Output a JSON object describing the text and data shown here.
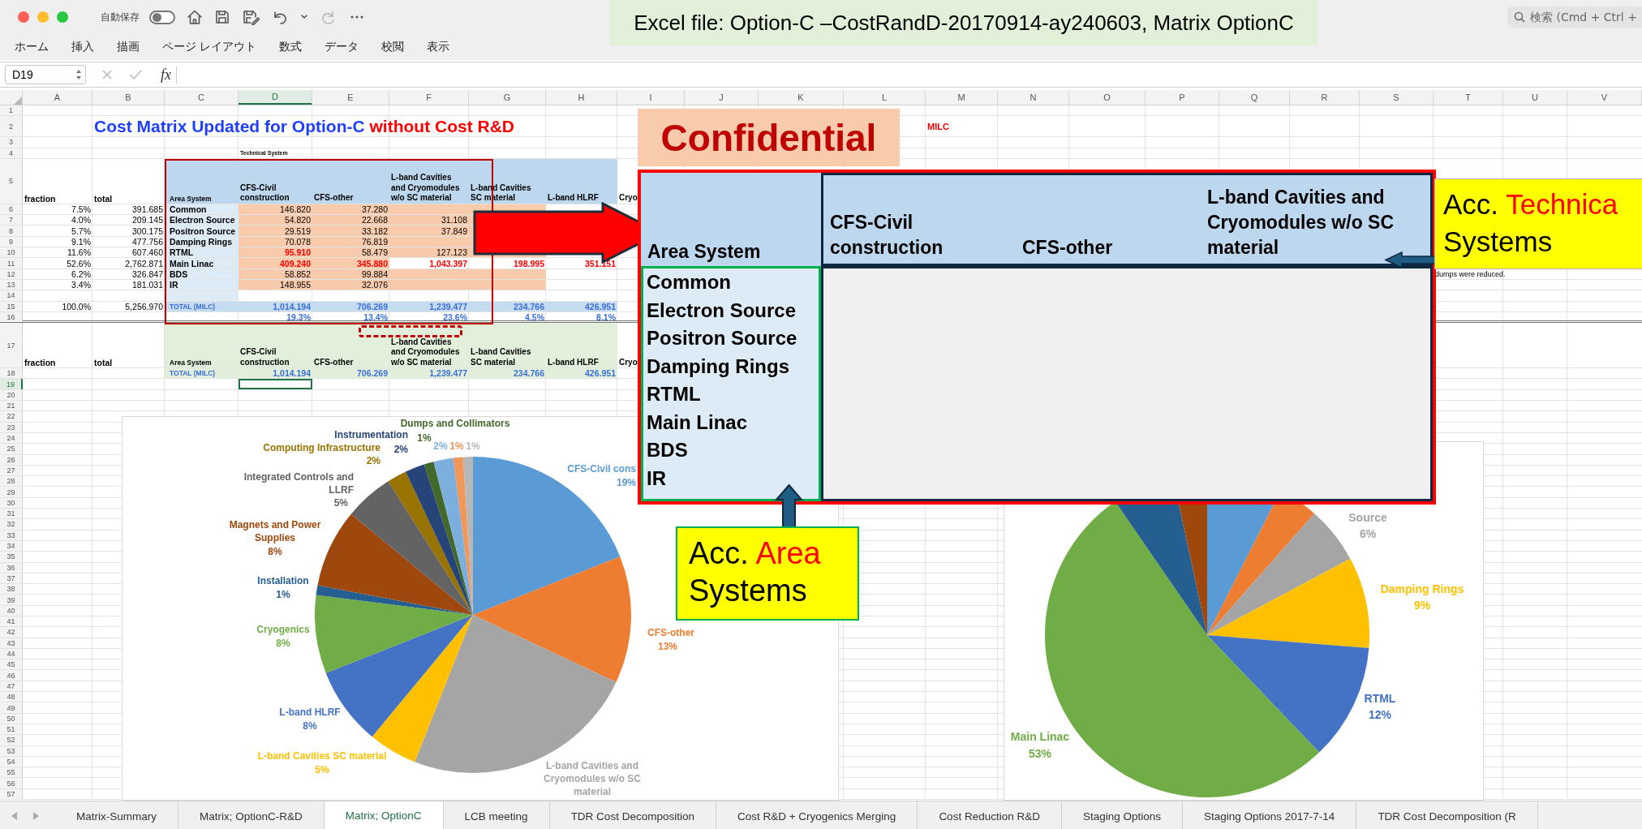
{
  "title_bar": {
    "autosave": {
      "label": "自動保存",
      "on": false
    },
    "quick_access": [
      {
        "kind": "home",
        "disabled": false
      },
      {
        "kind": "save",
        "disabled": false
      },
      {
        "kind": "save-as",
        "disabled": false
      },
      {
        "kind": "undo",
        "disabled": false
      },
      {
        "kind": "caret",
        "disabled": false
      },
      {
        "kind": "redo",
        "disabled": true
      },
      {
        "kind": "more",
        "disabled": false
      }
    ],
    "search": {
      "placeholder": "検索 (Cmd + Ctrl +"
    }
  },
  "caption": "Excel file: Option-C –CostRandD-20170914-ay240603, Matrix OptionC",
  "ribbon_tabs": [
    "ホーム",
    "挿入",
    "描画",
    "ページ レイアウト",
    "数式",
    "データ",
    "校閲",
    "表示"
  ],
  "formula_bar": {
    "name_box": "D19",
    "function_label": "fx"
  },
  "sheet": {
    "columns": [
      {
        "label": "A",
        "selected": false
      },
      {
        "label": "B",
        "selected": false
      },
      {
        "label": "C",
        "selected": false
      },
      {
        "label": "D",
        "selected": true
      },
      {
        "label": "E",
        "selected": false
      },
      {
        "label": "F",
        "selected": false
      },
      {
        "label": "G",
        "selected": false
      },
      {
        "label": "H",
        "selected": false
      },
      {
        "label": "I",
        "selected": false
      },
      {
        "label": "J",
        "selected": false
      },
      {
        "label": "K",
        "selected": false
      },
      {
        "label": "L",
        "selected": false
      },
      {
        "label": "M",
        "selected": false
      },
      {
        "label": "N",
        "selected": false
      },
      {
        "label": "O",
        "selected": false
      },
      {
        "label": "P",
        "selected": false
      },
      {
        "label": "Q",
        "selected": false
      },
      {
        "label": "R",
        "selected": false
      },
      {
        "label": "S",
        "selected": false
      },
      {
        "label": "T",
        "selected": false
      },
      {
        "label": "U",
        "selected": false
      },
      {
        "label": "V",
        "selected": false
      }
    ],
    "rows": [
      {
        "header": "1",
        "selected": false
      },
      {
        "header": "2",
        "selected": false,
        "kind": "title",
        "cells": [
          null,
          {
            "kind": "title",
            "parts": [
              {
                "text": "Cost Matrix Updated for Option-C",
                "color": "#1f3fff"
              },
              {
                "text": "without Cost R&D",
                "color": "#ff0000"
              }
            ]
          },
          null,
          null,
          null,
          null,
          null,
          null,
          null,
          null,
          null,
          null,
          {
            "kind": "note",
            "text": "MILC",
            "color": "#ff0000"
          }
        ]
      },
      {
        "header": "3",
        "selected": false
      },
      {
        "header": "4",
        "selected": false,
        "cells": [
          null,
          null,
          null,
          {
            "kind": "tiny",
            "text": "Technical System"
          }
        ]
      },
      {
        "header": "5",
        "selected": false,
        "kind": "head",
        "cells": [
          {
            "text": "fraction",
            "kind": "label"
          },
          {
            "text": "total",
            "kind": "label"
          },
          {
            "text": "Area System",
            "kind": "small"
          },
          {
            "text": "CFS-Civil construction",
            "kind": "head"
          },
          {
            "text": "CFS-other",
            "kind": "head"
          },
          {
            "text": "L-band Cavities and Cryomodules w/o SC material",
            "kind": "head"
          },
          {
            "text": "L-band Cavities SC material",
            "kind": "head"
          },
          {
            "text": "L-band HLRF",
            "kind": "head"
          },
          {
            "text": "Cryo",
            "kind": "head"
          }
        ]
      },
      {
        "header": "6",
        "selected": false,
        "kind": "data",
        "cells": [
          {
            "text": "7.5%",
            "kind": "num"
          },
          {
            "text": "391.685",
            "kind": "num"
          },
          {
            "text": "Common",
            "kind": "label"
          },
          {
            "text": "146.820",
            "kind": "num"
          },
          {
            "text": "37.280",
            "kind": "num"
          }
        ]
      },
      {
        "header": "7",
        "selected": false,
        "kind": "data",
        "cells": [
          {
            "text": "4.0%",
            "kind": "num"
          },
          {
            "text": "209.145",
            "kind": "num"
          },
          {
            "text": "Electron Source",
            "kind": "label"
          },
          {
            "text": "54.820",
            "kind": "num"
          },
          {
            "text": "22.668",
            "kind": "num"
          },
          {
            "text": "31.108",
            "kind": "num"
          }
        ]
      },
      {
        "header": "8",
        "selected": false,
        "kind": "data",
        "cells": [
          {
            "text": "5.7%",
            "kind": "num"
          },
          {
            "text": "300.175",
            "kind": "num"
          },
          {
            "text": "Positron Source",
            "kind": "label"
          },
          {
            "text": "29.519",
            "kind": "num"
          },
          {
            "text": "33.182",
            "kind": "num"
          },
          {
            "text": "37.849",
            "kind": "num"
          }
        ]
      },
      {
        "header": "9",
        "selected": false,
        "kind": "data",
        "cells": [
          {
            "text": "9.1%",
            "kind": "num"
          },
          {
            "text": "477.756",
            "kind": "num"
          },
          {
            "text": "Damping Rings",
            "kind": "label"
          },
          {
            "text": "70.078",
            "kind": "num"
          },
          {
            "text": "76.819",
            "kind": "num"
          }
        ]
      },
      {
        "header": "10",
        "selected": false,
        "kind": "data",
        "cells": [
          {
            "text": "11.6%",
            "kind": "num"
          },
          {
            "text": "607.460",
            "kind": "num"
          },
          {
            "text": "RTML",
            "kind": "label"
          },
          {
            "text": "95.910",
            "kind": "num",
            "color": "#ff0000"
          },
          {
            "text": "58.479",
            "kind": "num"
          },
          {
            "text": "127.123",
            "kind": "num"
          }
        ]
      },
      {
        "header": "11",
        "selected": false,
        "kind": "data-main",
        "cells": [
          {
            "text": "52.6%",
            "kind": "num"
          },
          {
            "text": "2,762.871",
            "kind": "num"
          },
          {
            "text": "Main Linac",
            "kind": "label"
          },
          {
            "text": "409.240",
            "kind": "num",
            "color": "#ff0000"
          },
          {
            "text": "345.880",
            "kind": "num",
            "color": "#ff0000"
          },
          {
            "text": "1,043.397",
            "kind": "num",
            "color": "#ff0000"
          },
          {
            "text": "198.995",
            "kind": "num",
            "color": "#ff0000"
          },
          {
            "text": "351.151",
            "kind": "num",
            "color": "#ff0000"
          }
        ]
      },
      {
        "header": "12",
        "selected": false,
        "kind": "data",
        "cells": [
          {
            "text": "6.2%",
            "kind": "num"
          },
          {
            "text": "326.847",
            "kind": "num"
          },
          {
            "text": "BDS",
            "kind": "label"
          },
          {
            "text": "58.852",
            "kind": "num"
          },
          {
            "text": "99.884",
            "kind": "num"
          },
          null,
          null,
          null,
          null,
          null,
          null,
          null,
          null,
          null,
          null,
          null,
          null,
          null,
          null,
          {
            "text": "dumps were reduced.",
            "kind": "text"
          }
        ]
      },
      {
        "header": "13",
        "selected": false,
        "kind": "data",
        "cells": [
          {
            "text": "3.4%",
            "kind": "num"
          },
          {
            "text": "181.031",
            "kind": "num"
          },
          {
            "text": "IR",
            "kind": "label"
          },
          {
            "text": "148.955",
            "kind": "num"
          },
          {
            "text": "32.076",
            "kind": "num"
          }
        ]
      },
      {
        "header": "14",
        "selected": false,
        "kind": "gap"
      },
      {
        "header": "15",
        "selected": false,
        "kind": "total",
        "cells": [
          {
            "text": "100.0%",
            "kind": "num"
          },
          {
            "text": "5,256.970",
            "kind": "num"
          },
          {
            "text": "TOTAL (MILC)",
            "kind": "small",
            "color": "#3a6fd8"
          },
          {
            "text": "1,014.194",
            "kind": "num",
            "color": "#3a6fd8"
          },
          {
            "text": "706.269",
            "kind": "num",
            "color": "#3a6fd8"
          },
          {
            "text": "1,239.477",
            "kind": "num",
            "color": "#3a6fd8"
          },
          {
            "text": "234.766",
            "kind": "num",
            "color": "#3a6fd8"
          },
          {
            "text": "426.951",
            "kind": "num",
            "color": "#3a6fd8"
          }
        ]
      },
      {
        "header": "16",
        "selected": false,
        "kind": "pct",
        "cells": [
          null,
          null,
          null,
          {
            "text": "19.3%",
            "kind": "num",
            "color": "#3a6fd8"
          },
          {
            "text": "13.4%",
            "kind": "num",
            "color": "#3a6fd8"
          },
          {
            "text": "23.6%",
            "kind": "num",
            "color": "#3a6fd8"
          },
          {
            "text": "4.5%",
            "kind": "num",
            "color": "#3a6fd8"
          },
          {
            "text": "8.1%",
            "kind": "num",
            "color": "#3a6fd8"
          }
        ]
      },
      {
        "header": "17",
        "selected": false,
        "kind": "head2",
        "cells": [
          {
            "text": "fraction",
            "kind": "label"
          },
          {
            "text": "total",
            "kind": "label"
          },
          {
            "text": "Area System",
            "kind": "small"
          },
          {
            "text": "CFS-Civil construction",
            "kind": "head"
          },
          {
            "text": "CFS-other",
            "kind": "head"
          },
          {
            "text": "L-band Cavities and Cryomodules w/o SC material",
            "kind": "head"
          },
          {
            "text": "L-band Cavities SC material",
            "kind": "head"
          },
          {
            "text": "L-band HLRF",
            "kind": "head"
          },
          {
            "text": "Cryo",
            "kind": "head"
          }
        ]
      },
      {
        "header": "18",
        "selected": false,
        "kind": "total2",
        "cells": [
          null,
          null,
          {
            "text": "TOTAL (MILC)",
            "kind": "small",
            "color": "#3a6fd8"
          },
          {
            "text": "1,014.194",
            "kind": "num",
            "color": "#3a6fd8"
          },
          {
            "text": "706.269",
            "kind": "num",
            "color": "#3a6fd8"
          },
          {
            "text": "1,239.477",
            "kind": "num",
            "color": "#3a6fd8"
          },
          {
            "text": "234.766",
            "kind": "num",
            "color": "#3a6fd8"
          },
          {
            "text": "426.951",
            "kind": "num",
            "color": "#3a6fd8"
          }
        ]
      },
      {
        "header": "19",
        "selected": true
      },
      {
        "header": "20",
        "selected": false
      },
      {
        "header": "21",
        "selected": false
      },
      {
        "header": "22",
        "selected": false
      },
      {
        "header": "23",
        "selected": false
      },
      {
        "header": "24",
        "selected": false
      },
      {
        "header": "25",
        "selected": false
      },
      {
        "header": "26",
        "selected": false
      },
      {
        "header": "27",
        "selected": false
      },
      {
        "header": "28",
        "selected": false
      },
      {
        "header": "29",
        "selected": false
      },
      {
        "header": "30",
        "selected": false
      },
      {
        "header": "31",
        "selected": false
      },
      {
        "header": "32",
        "selected": false
      },
      {
        "header": "33",
        "selected": false
      },
      {
        "header": "34",
        "selected": false
      },
      {
        "header": "35",
        "selected": false
      },
      {
        "header": "36",
        "selected": false
      },
      {
        "header": "37",
        "selected": false
      },
      {
        "header": "38",
        "selected": false
      },
      {
        "header": "39",
        "selected": false
      },
      {
        "header": "40",
        "selected": false
      },
      {
        "header": "41",
        "selected": false
      },
      {
        "header": "42",
        "selected": false
      },
      {
        "header": "43",
        "selected": false
      },
      {
        "header": "44",
        "selected": false
      },
      {
        "header": "45",
        "selected": false
      },
      {
        "header": "46",
        "selected": false
      },
      {
        "header": "47",
        "selected": false
      },
      {
        "header": "48",
        "selected": false
      },
      {
        "header": "49",
        "selected": false
      },
      {
        "header": "50",
        "selected": false
      },
      {
        "header": "51",
        "selected": false
      },
      {
        "header": "52",
        "selected": false
      },
      {
        "header": "53",
        "selected": false
      },
      {
        "header": "54",
        "selected": false
      },
      {
        "header": "55",
        "selected": false
      },
      {
        "header": "56",
        "selected": false
      },
      {
        "header": "57",
        "selected": false
      }
    ]
  },
  "stamp": "Confidential",
  "zoom_table": {
    "corner": "Area System",
    "columns": [
      "CFS-Civil construction",
      "CFS-other",
      "L-band Cavities and Cryomodules w/o SC material"
    ],
    "areas": [
      "Common",
      "Electron Source",
      "Positron Source",
      "Damping Rings",
      "RTML",
      "Main Linac",
      "BDS",
      "IR"
    ]
  },
  "callouts": [
    {
      "lines": [
        [
          {
            "text": "Acc.",
            "color": "#000000"
          },
          {
            "text": "Technica",
            "color": "#ff0000"
          }
        ],
        [
          {
            "text": "Systems",
            "color": "#000000"
          }
        ]
      ]
    },
    {
      "lines": [
        [
          {
            "text": "Acc.",
            "color": "#000000"
          },
          {
            "text": "Area",
            "color": "#ff0000"
          }
        ],
        [
          {
            "text": "Systems",
            "color": "#000000"
          }
        ]
      ]
    }
  ],
  "left_chart": {
    "chart_data": {
      "type": "pie",
      "categories": [
        "CFS-Civil cons",
        "CFS-other",
        "L-band Cavities and Cryomodules w/o SC material",
        "L-band Cavities SC material",
        "L-band HLRF",
        "Cryogenics",
        "Installation",
        "Magnets and Power Supplies",
        "Integrated Controls and LLRF",
        "Computing Infrastructure",
        "Instrumentation",
        "Dumps and Collimators",
        null,
        null,
        null
      ],
      "values": [
        19,
        13,
        24,
        5,
        8,
        8,
        1,
        8,
        5,
        2,
        2,
        1,
        2,
        1,
        1
      ],
      "colors": [
        "#5b9bd5",
        "#ed7d31",
        "#a5a5a5",
        "#ffc000",
        "#4472c4",
        "#70ad47",
        "#255e91",
        "#9e480e",
        "#636363",
        "#997300",
        "#264478",
        "#43682b",
        "#7cafdd",
        "#f1975a",
        "#b7b7b7"
      ],
      "value_labels": [
        "19%",
        "13%",
        null,
        "5%",
        "8%",
        "8%",
        "1%",
        "8%",
        "5%",
        "2%",
        "2%",
        "1%",
        "2%",
        "1%",
        "1%"
      ]
    }
  },
  "right_chart": {
    "chart_data": {
      "type": "pie",
      "categories": [
        null,
        null,
        "Source",
        "Damping Rings",
        "RTML",
        "Main Linac",
        null,
        null
      ],
      "values": [
        7.5,
        4.0,
        5.7,
        9.1,
        11.6,
        52.6,
        6.2,
        3.4
      ],
      "colors": [
        "#5b9bd5",
        "#ed7d31",
        "#a5a5a5",
        "#ffc000",
        "#4472c4",
        "#70ad47",
        "#255e91",
        "#9e480e"
      ],
      "value_labels": [
        null,
        null,
        "6%",
        "9%",
        "12%",
        "53%",
        null,
        null
      ]
    }
  },
  "sheet_tabs": [
    {
      "label": "Matrix-Summary",
      "selected": false
    },
    {
      "label": "Matrix; OptionC-R&D",
      "selected": false
    },
    {
      "label": "Matrix; OptionC",
      "selected": true
    },
    {
      "label": "LCB meeting",
      "selected": false
    },
    {
      "label": "TDR Cost Decomposition",
      "selected": false
    },
    {
      "label": "Cost R&D + Cryogenics Merging",
      "selected": false
    },
    {
      "label": "Cost Reduction R&D",
      "selected": false
    },
    {
      "label": "Staging Options",
      "selected": false
    },
    {
      "label": "Staging Options 2017-7-14",
      "selected": false
    },
    {
      "label": "TDR Cost Decomposition (R",
      "selected": false
    }
  ]
}
